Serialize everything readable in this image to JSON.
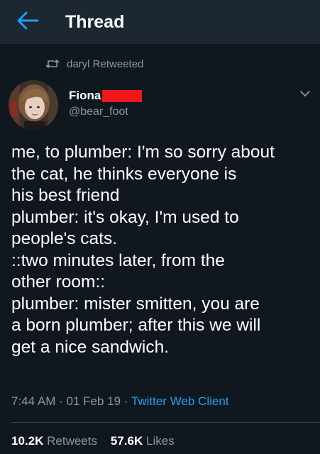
{
  "header": {
    "title": "Thread",
    "back_icon": "arrow-left-icon"
  },
  "retweet": {
    "icon": "retweet-icon",
    "text": "daryl Retweeted"
  },
  "author": {
    "name": "Fiona",
    "handle": "@bear_foot",
    "redaction_color": "#f11619"
  },
  "tweet": {
    "text": "me, to plumber: I'm so sorry about\nthe cat, he thinks everyone is\nhis best friend\nplumber: it's okay, I'm used to\npeople's cats.\n::two minutes later, from the\nother room::\nplumber: mister smitten, you are\na born plumber; after this we will\nget a nice sandwich."
  },
  "meta": {
    "time": "7:44 AM",
    "separator": "·",
    "date": "01 Feb 19",
    "client": "Twitter Web Client"
  },
  "stats": {
    "retweets_count": "10.2K",
    "retweets_label": "Retweets",
    "likes_count": "57.6K",
    "likes_label": "Likes"
  },
  "colors": {
    "background": "#10171e",
    "header": "#1c2732",
    "accent": "#1da1f2",
    "muted": "#8899a6"
  }
}
